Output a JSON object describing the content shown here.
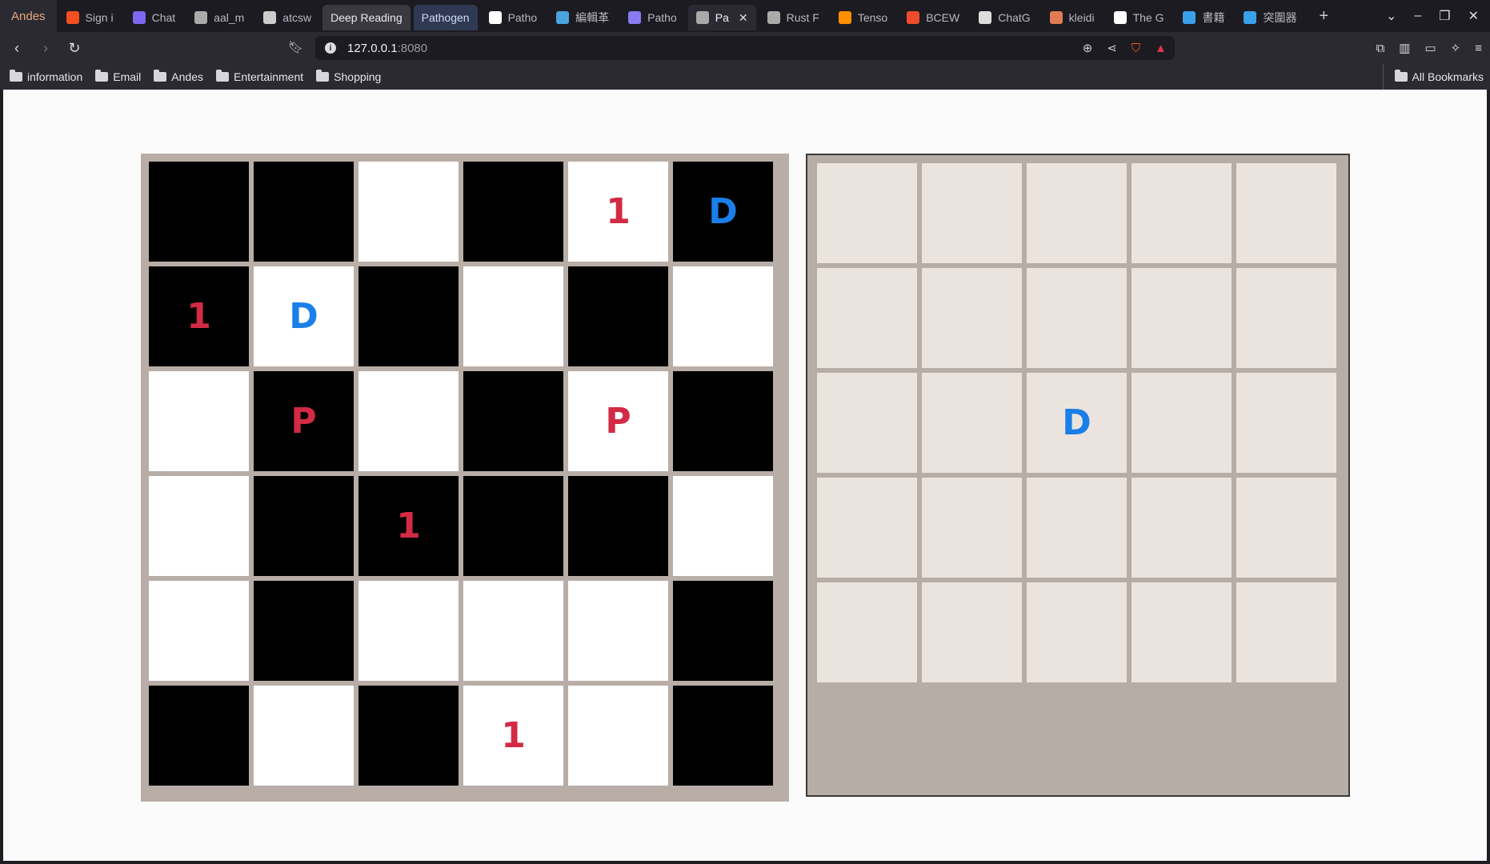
{
  "browser": {
    "profile": "Andes",
    "tabs": [
      {
        "label": "Sign i",
        "icon": "microsoft-icon",
        "color": "#f25022",
        "state": "normal"
      },
      {
        "label": "Chat",
        "icon": "chat-icon",
        "color": "#7b68ee",
        "state": "normal"
      },
      {
        "label": "aal_m",
        "icon": "globe-icon",
        "color": "#aaaaaa",
        "state": "normal"
      },
      {
        "label": "atcsw",
        "icon": "cube-icon",
        "color": "#cccccc",
        "state": "normal"
      },
      {
        "label": "Deep Reading",
        "icon": "",
        "color": "",
        "state": "highlight"
      },
      {
        "label": "Pathogen",
        "icon": "",
        "color": "",
        "state": "highlight-blue"
      },
      {
        "label": "Patho",
        "icon": "github-icon",
        "color": "#ffffff",
        "state": "normal"
      },
      {
        "label": "編輯革",
        "icon": "doc-icon",
        "color": "#4aa3df",
        "state": "normal"
      },
      {
        "label": "Patho",
        "icon": "chat-icon",
        "color": "#8a7bf0",
        "state": "normal"
      },
      {
        "label": "Pa",
        "icon": "globe-icon",
        "color": "#aaaaaa",
        "state": "active"
      },
      {
        "label": "Rust F",
        "icon": "globe-icon",
        "color": "#aaaaaa",
        "state": "normal"
      },
      {
        "label": "Tenso",
        "icon": "tensorflow-icon",
        "color": "#ff8f00",
        "state": "normal"
      },
      {
        "label": "BCEW",
        "icon": "pytorch-icon",
        "color": "#ee4c2c",
        "state": "normal"
      },
      {
        "label": "ChatG",
        "icon": "openai-icon",
        "color": "#dddddd",
        "state": "normal"
      },
      {
        "label": "kleidi",
        "icon": "brand-icon",
        "color": "#e07b53",
        "state": "normal"
      },
      {
        "label": "The G",
        "icon": "c-icon",
        "color": "#ffffff",
        "state": "normal"
      },
      {
        "label": "書籍",
        "icon": "book-icon",
        "color": "#3aa0e8",
        "state": "normal"
      },
      {
        "label": "突圍器",
        "icon": "book-icon",
        "color": "#3aa0e8",
        "state": "normal"
      }
    ],
    "url_host": "127.0.0.1",
    "url_port": ":8080",
    "bookmarks": [
      "information",
      "Email",
      "Andes",
      "Entertainment",
      "Shopping"
    ],
    "all_bookmarks": "All Bookmarks"
  },
  "game": {
    "left_board": [
      [
        {
          "c": "black",
          "t": ""
        },
        {
          "c": "black",
          "t": ""
        },
        {
          "c": "white",
          "t": ""
        },
        {
          "c": "black",
          "t": ""
        },
        {
          "c": "white",
          "t": "1"
        },
        {
          "c": "black",
          "t": "D"
        }
      ],
      [
        {
          "c": "black",
          "t": "1"
        },
        {
          "c": "white",
          "t": "D"
        },
        {
          "c": "black",
          "t": ""
        },
        {
          "c": "white",
          "t": ""
        },
        {
          "c": "black",
          "t": ""
        },
        {
          "c": "white",
          "t": ""
        }
      ],
      [
        {
          "c": "white",
          "t": ""
        },
        {
          "c": "black",
          "t": "P"
        },
        {
          "c": "white",
          "t": ""
        },
        {
          "c": "black",
          "t": ""
        },
        {
          "c": "white",
          "t": "P"
        },
        {
          "c": "black",
          "t": ""
        }
      ],
      [
        {
          "c": "white",
          "t": ""
        },
        {
          "c": "black",
          "t": ""
        },
        {
          "c": "black",
          "t": "1"
        },
        {
          "c": "black",
          "t": ""
        },
        {
          "c": "black",
          "t": ""
        },
        {
          "c": "white",
          "t": ""
        }
      ],
      [
        {
          "c": "white",
          "t": ""
        },
        {
          "c": "black",
          "t": ""
        },
        {
          "c": "white",
          "t": ""
        },
        {
          "c": "white",
          "t": ""
        },
        {
          "c": "white",
          "t": ""
        },
        {
          "c": "black",
          "t": ""
        }
      ],
      [
        {
          "c": "black",
          "t": ""
        },
        {
          "c": "white",
          "t": ""
        },
        {
          "c": "black",
          "t": ""
        },
        {
          "c": "white",
          "t": "1"
        },
        {
          "c": "white",
          "t": ""
        },
        {
          "c": "black",
          "t": ""
        }
      ]
    ],
    "right_board": [
      [
        "",
        "",
        "",
        "",
        ""
      ],
      [
        "",
        "",
        "",
        "",
        ""
      ],
      [
        "",
        "",
        "D",
        "",
        ""
      ],
      [
        "",
        "",
        "",
        "",
        ""
      ],
      [
        "",
        "",
        "",
        "",
        ""
      ]
    ],
    "colors": {
      "red_glyph": "#d32a45",
      "blue_glyph": "#1a7fe8",
      "D": "#1a7fe8",
      "1": "#d32a45",
      "P": "#d32a45"
    }
  }
}
